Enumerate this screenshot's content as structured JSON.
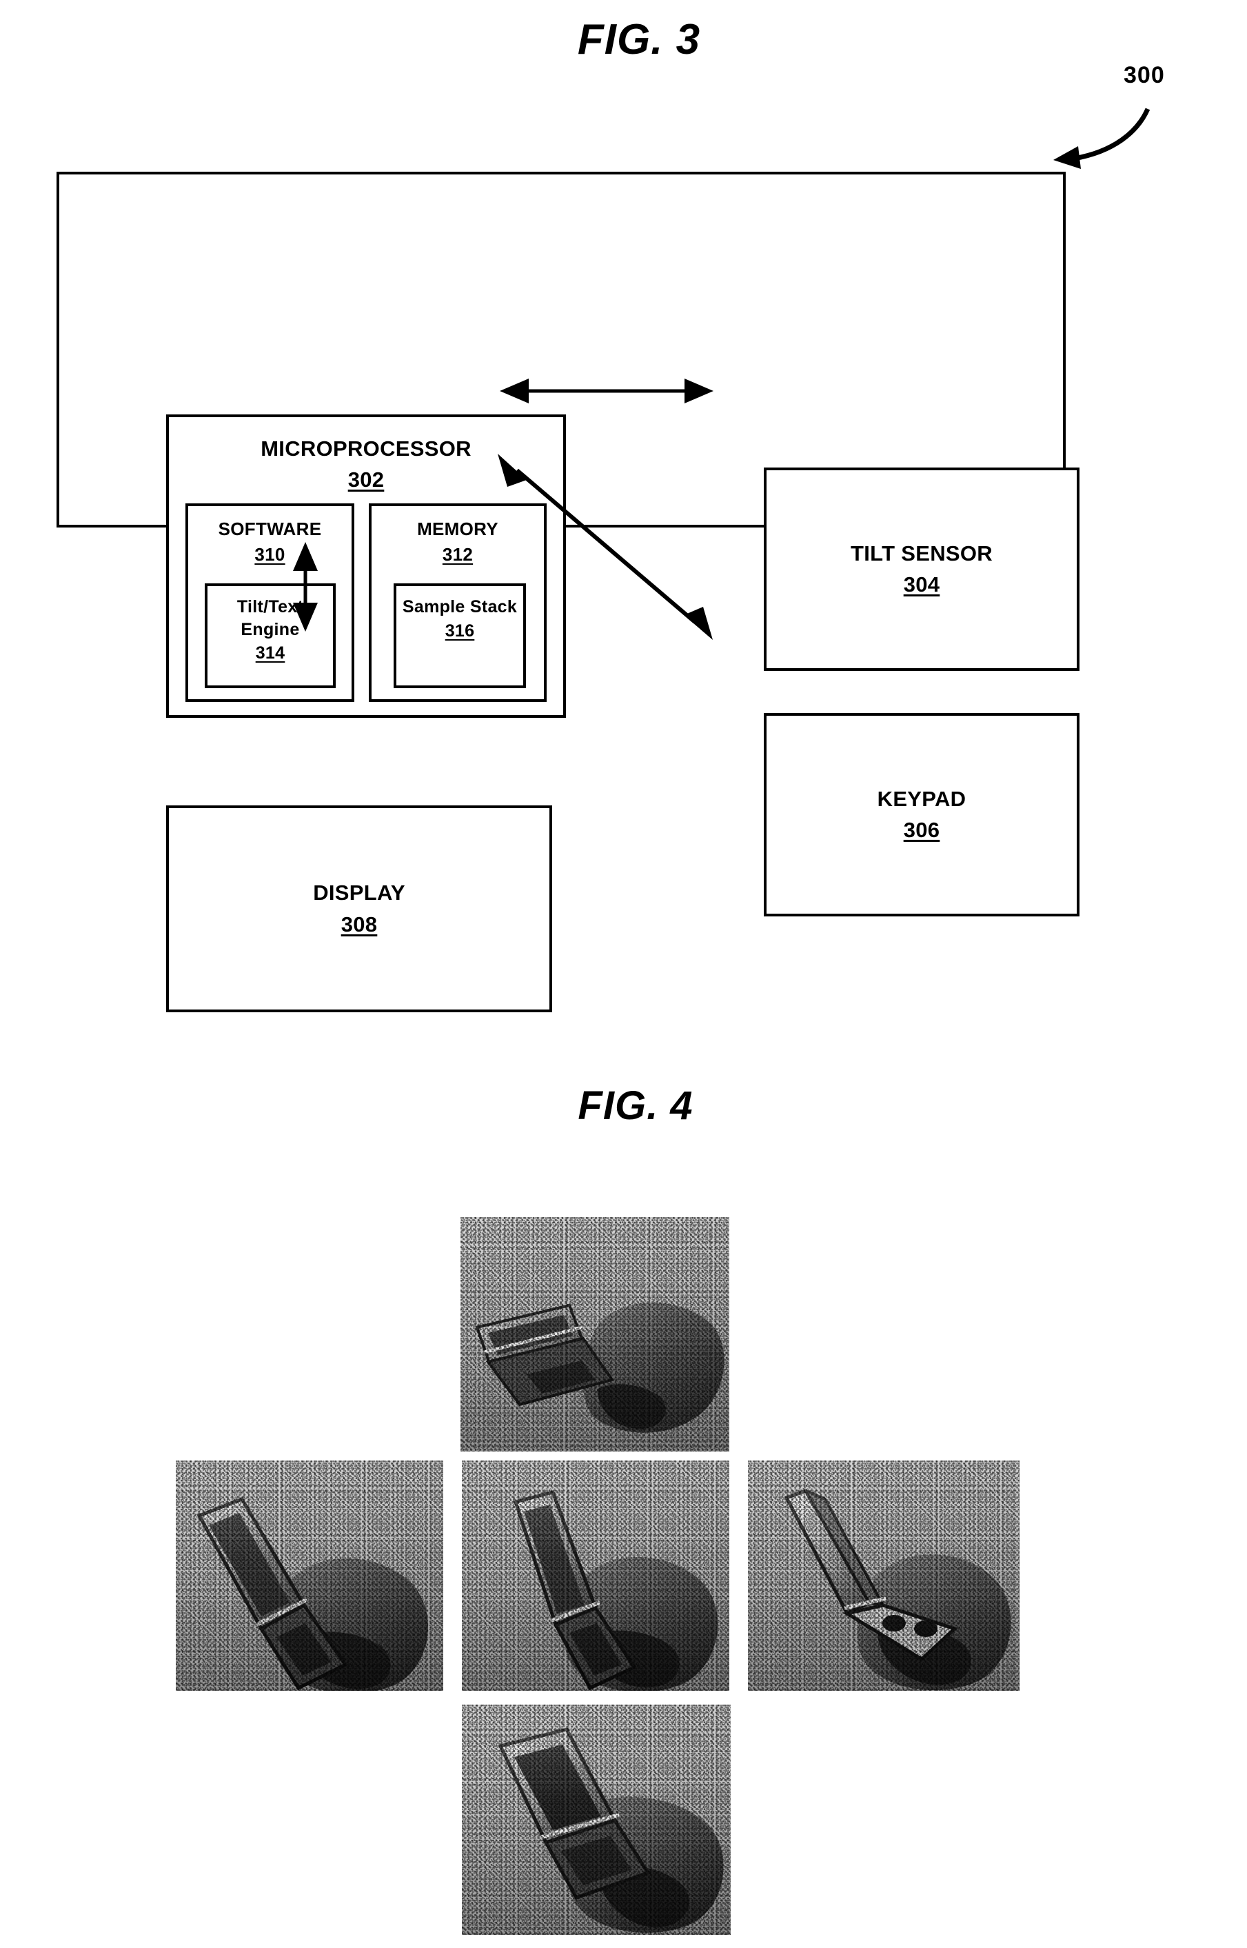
{
  "figures": [
    {
      "id": "fig3",
      "title": "FIG. 3",
      "reference_numeral": "300",
      "type": "block-diagram",
      "blocks": [
        {
          "key": "device",
          "label": "",
          "numeral": "",
          "role": "outer-enclosure"
        },
        {
          "key": "microprocessor",
          "label": "MICROPROCESSOR",
          "numeral": "302",
          "role": "component"
        },
        {
          "key": "software",
          "label": "SOFTWARE",
          "numeral": "310",
          "role": "sub-component"
        },
        {
          "key": "tilt_text_engine",
          "label": "Tilt/Text Engine",
          "numeral": "314",
          "role": "sub-sub-component"
        },
        {
          "key": "memory",
          "label": "MEMORY",
          "numeral": "312",
          "role": "sub-component"
        },
        {
          "key": "sample_stack",
          "label": "Sample Stack",
          "numeral": "316",
          "role": "sub-sub-component"
        },
        {
          "key": "tilt_sensor",
          "label": "TILT SENSOR",
          "numeral": "304",
          "role": "component"
        },
        {
          "key": "keypad",
          "label": "KEYPAD",
          "numeral": "306",
          "role": "component"
        },
        {
          "key": "display",
          "label": "DISPLAY",
          "numeral": "308",
          "role": "component"
        }
      ],
      "connections": [
        {
          "from": "microprocessor",
          "to": "tilt_sensor",
          "style": "double-headed",
          "orientation": "horizontal"
        },
        {
          "from": "microprocessor",
          "to": "keypad",
          "style": "double-headed",
          "orientation": "diagonal"
        },
        {
          "from": "microprocessor",
          "to": "display",
          "style": "double-headed",
          "orientation": "vertical"
        }
      ]
    },
    {
      "id": "fig4",
      "title": "FIG. 4",
      "type": "photo-grid",
      "layout": "plus-shaped cross: one top, three middle, one bottom",
      "photos": [
        {
          "position": "top",
          "caption": "hand holding open flip phone tilted away from viewer"
        },
        {
          "position": "middle-left",
          "caption": "hand holding open flip phone tilted left"
        },
        {
          "position": "middle-center",
          "caption": "hand holding open flip phone upright / neutral"
        },
        {
          "position": "middle-right",
          "caption": "hand holding open flip phone tilted right"
        },
        {
          "position": "bottom",
          "caption": "hand holding open flip phone tilted toward viewer"
        }
      ]
    }
  ],
  "colors": {
    "ink": "#000000",
    "paper": "#ffffff",
    "photo_base": "#b9b9b9"
  }
}
